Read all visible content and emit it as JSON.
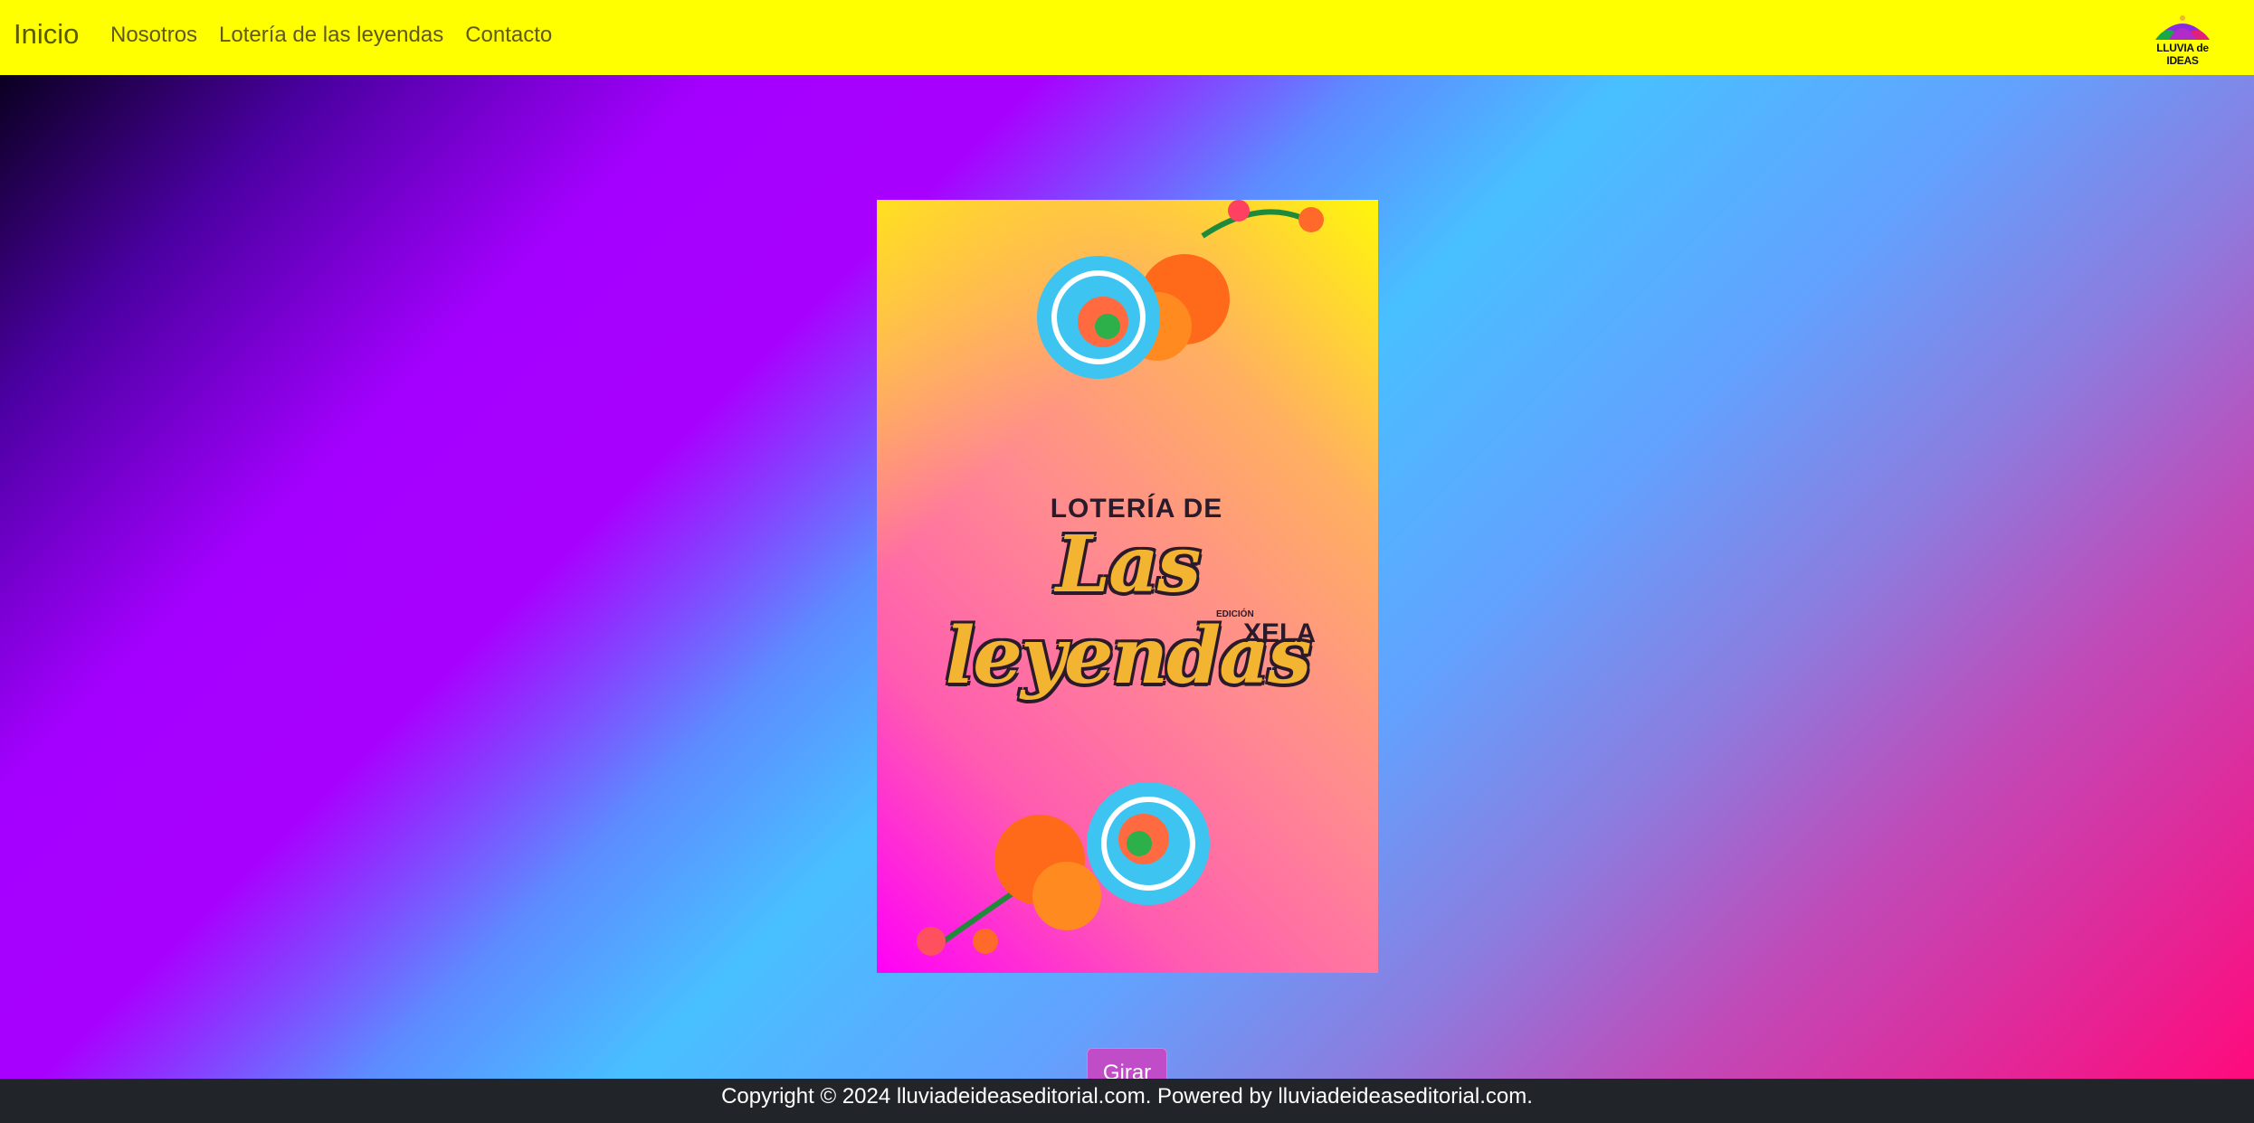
{
  "navbar": {
    "brand": "Inicio",
    "links": [
      "Nosotros",
      "Lotería de las leyendas",
      "Contacto"
    ],
    "logo_text": "LLUVIA de IDEAS"
  },
  "card": {
    "title_small": "LOTERÍA DE",
    "title_big": "Las leyendas",
    "edition_label": "EDICIÓN",
    "edition": "XELA"
  },
  "action": {
    "button_label": "Girar"
  },
  "footer": {
    "text": "Copyright © 2024 lluviadeideaseditorial.com. Powered by lluviadeideaseditorial.com."
  },
  "colors": {
    "navbar": "#ffff00",
    "button": "#c04cc8",
    "footer": "#212529"
  }
}
